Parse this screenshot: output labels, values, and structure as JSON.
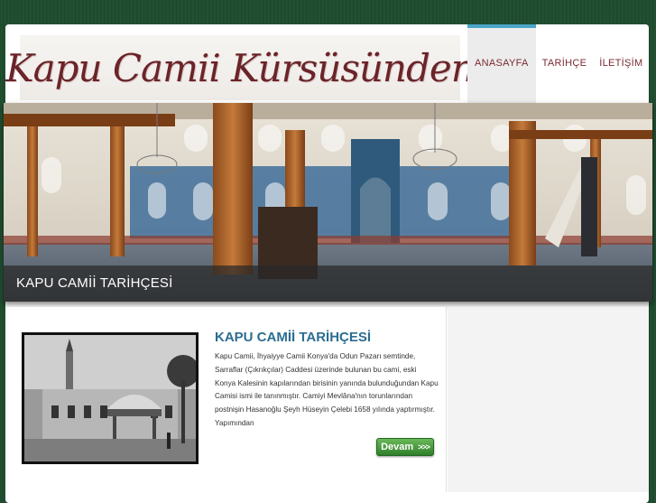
{
  "site": {
    "logo_text": "Kapu Camii Kürsüsünden"
  },
  "nav": {
    "items": [
      {
        "label": "ANASAYFA",
        "active": true
      },
      {
        "label": "TARİHÇE",
        "active": false
      },
      {
        "label": "İLETİŞİM",
        "active": false
      }
    ]
  },
  "slider": {
    "caption": "KAPU CAMİİ TARİHÇESİ"
  },
  "article": {
    "title": "KAPU CAMİİ TARİHÇESİ",
    "lines": [
      "Kapu Camii, İhyaiyye Camii   Konya'da Odun Pazarı semtinde,",
      "Sarraflar (Çıkrıkçılar) Caddesi üzerinde bulunan bu cami, eski",
      "Konya Kalesinin kapılarından birisinin yanında bulunduğundan Kapu",
      "Camisi ismi ile tanınmıştır. Camiyi Mevlâna'nın torunlarından",
      "postnişin Hasanoğlu Şeyh Hüseyin Çelebi 1658 yılında yaptırmıştır.",
      "Yapımından"
    ],
    "button_label": "Devam",
    "button_arrows": ">>>"
  },
  "colors": {
    "accent": "#4aa6c8",
    "brand": "#7a2a32",
    "title": "#2c6d91",
    "button": "#3f8f36"
  }
}
